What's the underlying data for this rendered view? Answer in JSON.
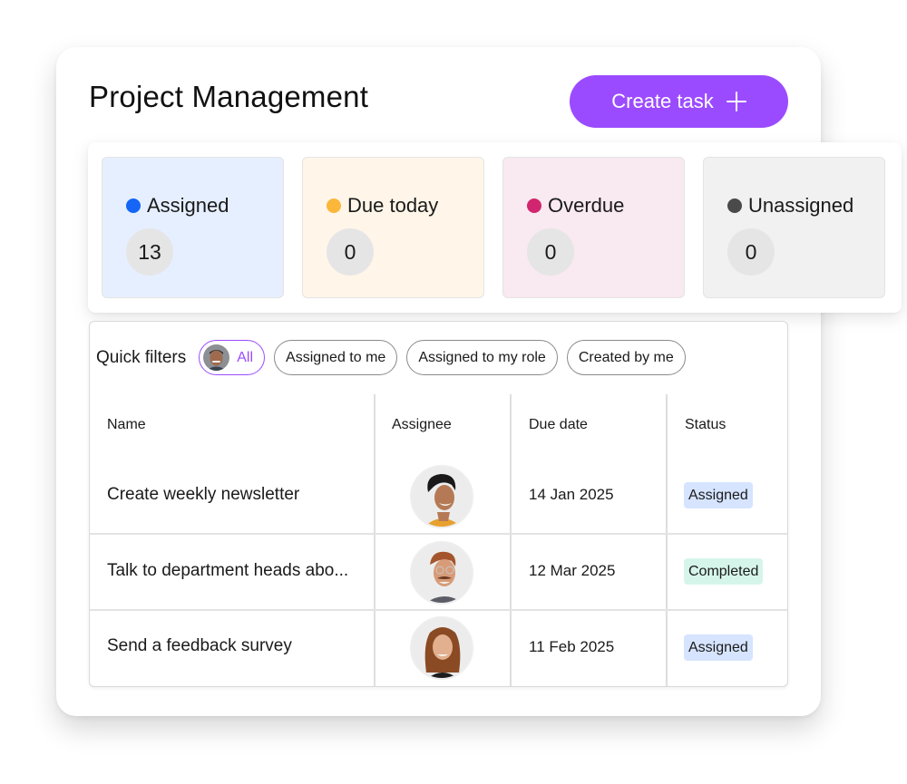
{
  "header": {
    "title": "Project Management",
    "create_button_label": "Create task",
    "create_button_icon": "plus-icon",
    "accent_color": "#9b4bff"
  },
  "stats": [
    {
      "label": "Assigned",
      "count": "13",
      "dot_color": "#1565f7",
      "bg_color": "#e6efff"
    },
    {
      "label": "Due today",
      "count": "0",
      "dot_color": "#fbb73a",
      "bg_color": "#fff6e9"
    },
    {
      "label": "Overdue",
      "count": "0",
      "dot_color": "#d1266f",
      "bg_color": "#f9e9f0"
    },
    {
      "label": "Unassigned",
      "count": "0",
      "dot_color": "#4a4a4a",
      "bg_color": "#f1f1f1"
    }
  ],
  "filters": {
    "label": "Quick filters",
    "chips": [
      {
        "label": "All",
        "active": true,
        "icon": "user-avatar"
      },
      {
        "label": "Assigned to me",
        "active": false
      },
      {
        "label": "Assigned to my role",
        "active": false
      },
      {
        "label": "Created by me",
        "active": false
      }
    ]
  },
  "table": {
    "columns": [
      "Name",
      "Assignee",
      "Due date",
      "Status"
    ],
    "rows": [
      {
        "name": "Create weekly newsletter",
        "assignee": "avatar-woman-curly-hair",
        "due_date": "14 Jan 2025",
        "status": "Assigned",
        "status_color": "#d6e4ff"
      },
      {
        "name": "Talk to department heads abo...",
        "assignee": "avatar-man-glasses-mustache",
        "due_date": "12 Mar 2025",
        "status": "Completed",
        "status_color": "#d6f5ea"
      },
      {
        "name": "Send a feedback survey",
        "assignee": "avatar-woman-brown-hair",
        "due_date": "11 Feb 2025",
        "status": "Assigned",
        "status_color": "#d6e4ff"
      }
    ]
  }
}
